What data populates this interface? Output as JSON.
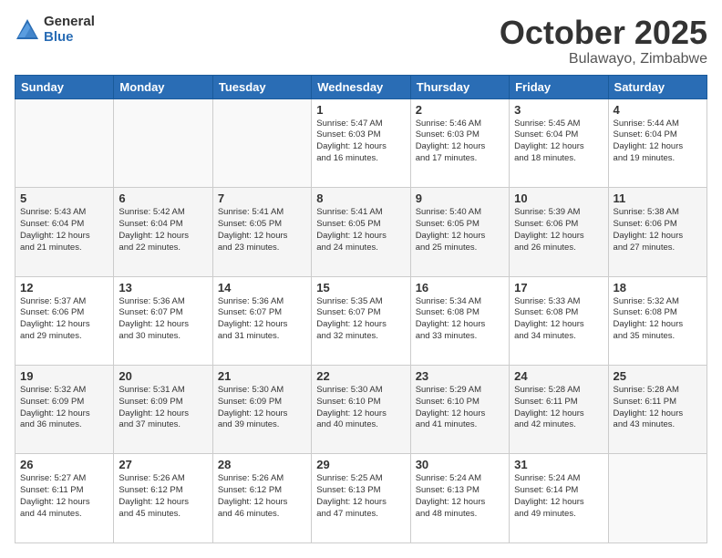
{
  "logo": {
    "general": "General",
    "blue": "Blue"
  },
  "title": "October 2025",
  "location": "Bulawayo, Zimbabwe",
  "days_header": [
    "Sunday",
    "Monday",
    "Tuesday",
    "Wednesday",
    "Thursday",
    "Friday",
    "Saturday"
  ],
  "weeks": [
    {
      "shaded": false,
      "days": [
        {
          "num": "",
          "info": ""
        },
        {
          "num": "",
          "info": ""
        },
        {
          "num": "",
          "info": ""
        },
        {
          "num": "1",
          "info": "Sunrise: 5:47 AM\nSunset: 6:03 PM\nDaylight: 12 hours\nand 16 minutes."
        },
        {
          "num": "2",
          "info": "Sunrise: 5:46 AM\nSunset: 6:03 PM\nDaylight: 12 hours\nand 17 minutes."
        },
        {
          "num": "3",
          "info": "Sunrise: 5:45 AM\nSunset: 6:04 PM\nDaylight: 12 hours\nand 18 minutes."
        },
        {
          "num": "4",
          "info": "Sunrise: 5:44 AM\nSunset: 6:04 PM\nDaylight: 12 hours\nand 19 minutes."
        }
      ]
    },
    {
      "shaded": true,
      "days": [
        {
          "num": "5",
          "info": "Sunrise: 5:43 AM\nSunset: 6:04 PM\nDaylight: 12 hours\nand 21 minutes."
        },
        {
          "num": "6",
          "info": "Sunrise: 5:42 AM\nSunset: 6:04 PM\nDaylight: 12 hours\nand 22 minutes."
        },
        {
          "num": "7",
          "info": "Sunrise: 5:41 AM\nSunset: 6:05 PM\nDaylight: 12 hours\nand 23 minutes."
        },
        {
          "num": "8",
          "info": "Sunrise: 5:41 AM\nSunset: 6:05 PM\nDaylight: 12 hours\nand 24 minutes."
        },
        {
          "num": "9",
          "info": "Sunrise: 5:40 AM\nSunset: 6:05 PM\nDaylight: 12 hours\nand 25 minutes."
        },
        {
          "num": "10",
          "info": "Sunrise: 5:39 AM\nSunset: 6:06 PM\nDaylight: 12 hours\nand 26 minutes."
        },
        {
          "num": "11",
          "info": "Sunrise: 5:38 AM\nSunset: 6:06 PM\nDaylight: 12 hours\nand 27 minutes."
        }
      ]
    },
    {
      "shaded": false,
      "days": [
        {
          "num": "12",
          "info": "Sunrise: 5:37 AM\nSunset: 6:06 PM\nDaylight: 12 hours\nand 29 minutes."
        },
        {
          "num": "13",
          "info": "Sunrise: 5:36 AM\nSunset: 6:07 PM\nDaylight: 12 hours\nand 30 minutes."
        },
        {
          "num": "14",
          "info": "Sunrise: 5:36 AM\nSunset: 6:07 PM\nDaylight: 12 hours\nand 31 minutes."
        },
        {
          "num": "15",
          "info": "Sunrise: 5:35 AM\nSunset: 6:07 PM\nDaylight: 12 hours\nand 32 minutes."
        },
        {
          "num": "16",
          "info": "Sunrise: 5:34 AM\nSunset: 6:08 PM\nDaylight: 12 hours\nand 33 minutes."
        },
        {
          "num": "17",
          "info": "Sunrise: 5:33 AM\nSunset: 6:08 PM\nDaylight: 12 hours\nand 34 minutes."
        },
        {
          "num": "18",
          "info": "Sunrise: 5:32 AM\nSunset: 6:08 PM\nDaylight: 12 hours\nand 35 minutes."
        }
      ]
    },
    {
      "shaded": true,
      "days": [
        {
          "num": "19",
          "info": "Sunrise: 5:32 AM\nSunset: 6:09 PM\nDaylight: 12 hours\nand 36 minutes."
        },
        {
          "num": "20",
          "info": "Sunrise: 5:31 AM\nSunset: 6:09 PM\nDaylight: 12 hours\nand 37 minutes."
        },
        {
          "num": "21",
          "info": "Sunrise: 5:30 AM\nSunset: 6:09 PM\nDaylight: 12 hours\nand 39 minutes."
        },
        {
          "num": "22",
          "info": "Sunrise: 5:30 AM\nSunset: 6:10 PM\nDaylight: 12 hours\nand 40 minutes."
        },
        {
          "num": "23",
          "info": "Sunrise: 5:29 AM\nSunset: 6:10 PM\nDaylight: 12 hours\nand 41 minutes."
        },
        {
          "num": "24",
          "info": "Sunrise: 5:28 AM\nSunset: 6:11 PM\nDaylight: 12 hours\nand 42 minutes."
        },
        {
          "num": "25",
          "info": "Sunrise: 5:28 AM\nSunset: 6:11 PM\nDaylight: 12 hours\nand 43 minutes."
        }
      ]
    },
    {
      "shaded": false,
      "days": [
        {
          "num": "26",
          "info": "Sunrise: 5:27 AM\nSunset: 6:11 PM\nDaylight: 12 hours\nand 44 minutes."
        },
        {
          "num": "27",
          "info": "Sunrise: 5:26 AM\nSunset: 6:12 PM\nDaylight: 12 hours\nand 45 minutes."
        },
        {
          "num": "28",
          "info": "Sunrise: 5:26 AM\nSunset: 6:12 PM\nDaylight: 12 hours\nand 46 minutes."
        },
        {
          "num": "29",
          "info": "Sunrise: 5:25 AM\nSunset: 6:13 PM\nDaylight: 12 hours\nand 47 minutes."
        },
        {
          "num": "30",
          "info": "Sunrise: 5:24 AM\nSunset: 6:13 PM\nDaylight: 12 hours\nand 48 minutes."
        },
        {
          "num": "31",
          "info": "Sunrise: 5:24 AM\nSunset: 6:14 PM\nDaylight: 12 hours\nand 49 minutes."
        },
        {
          "num": "",
          "info": ""
        }
      ]
    }
  ]
}
